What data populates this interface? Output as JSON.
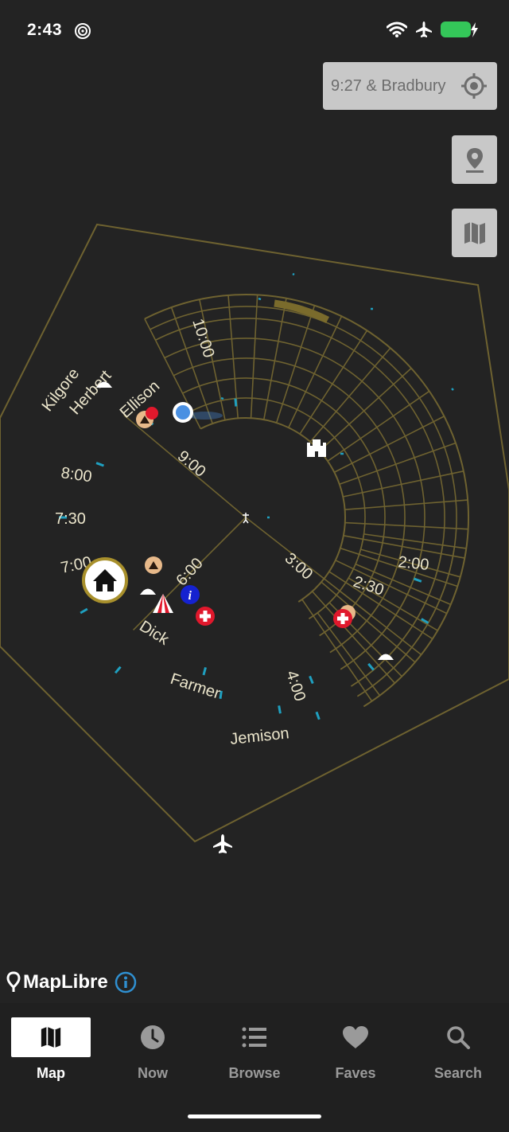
{
  "status_bar": {
    "time": "2:43"
  },
  "map": {
    "location_button_text": "9:27 & Bradbury",
    "attribution": "MapLibre",
    "street_labels": {
      "kilgore": "Kilgore",
      "herbert": "Herbert",
      "ellison": "Ellison",
      "dick": "Dick",
      "farmer": "Farmer",
      "jemison": "Jemison"
    },
    "time_labels": {
      "t1000": "10:00",
      "t900": "9:00",
      "t800": "8:00",
      "t730": "7:30",
      "t700": "7:00",
      "t600": "6:00",
      "t400": "4:00",
      "t300": "3:00",
      "t230": "2:30",
      "t200": "2:00"
    }
  },
  "tabs": [
    {
      "label": "Map",
      "icon": "map-icon",
      "active": true
    },
    {
      "label": "Now",
      "icon": "clock-icon",
      "active": false
    },
    {
      "label": "Browse",
      "icon": "list-icon",
      "active": false
    },
    {
      "label": "Faves",
      "icon": "heart-icon",
      "active": false
    },
    {
      "label": "Search",
      "icon": "search-icon",
      "active": false
    }
  ],
  "colors": {
    "background": "#232323",
    "street_lines": "#6e6230",
    "accent_blue": "#1fa0c0",
    "user_location": "#4a90e2"
  }
}
